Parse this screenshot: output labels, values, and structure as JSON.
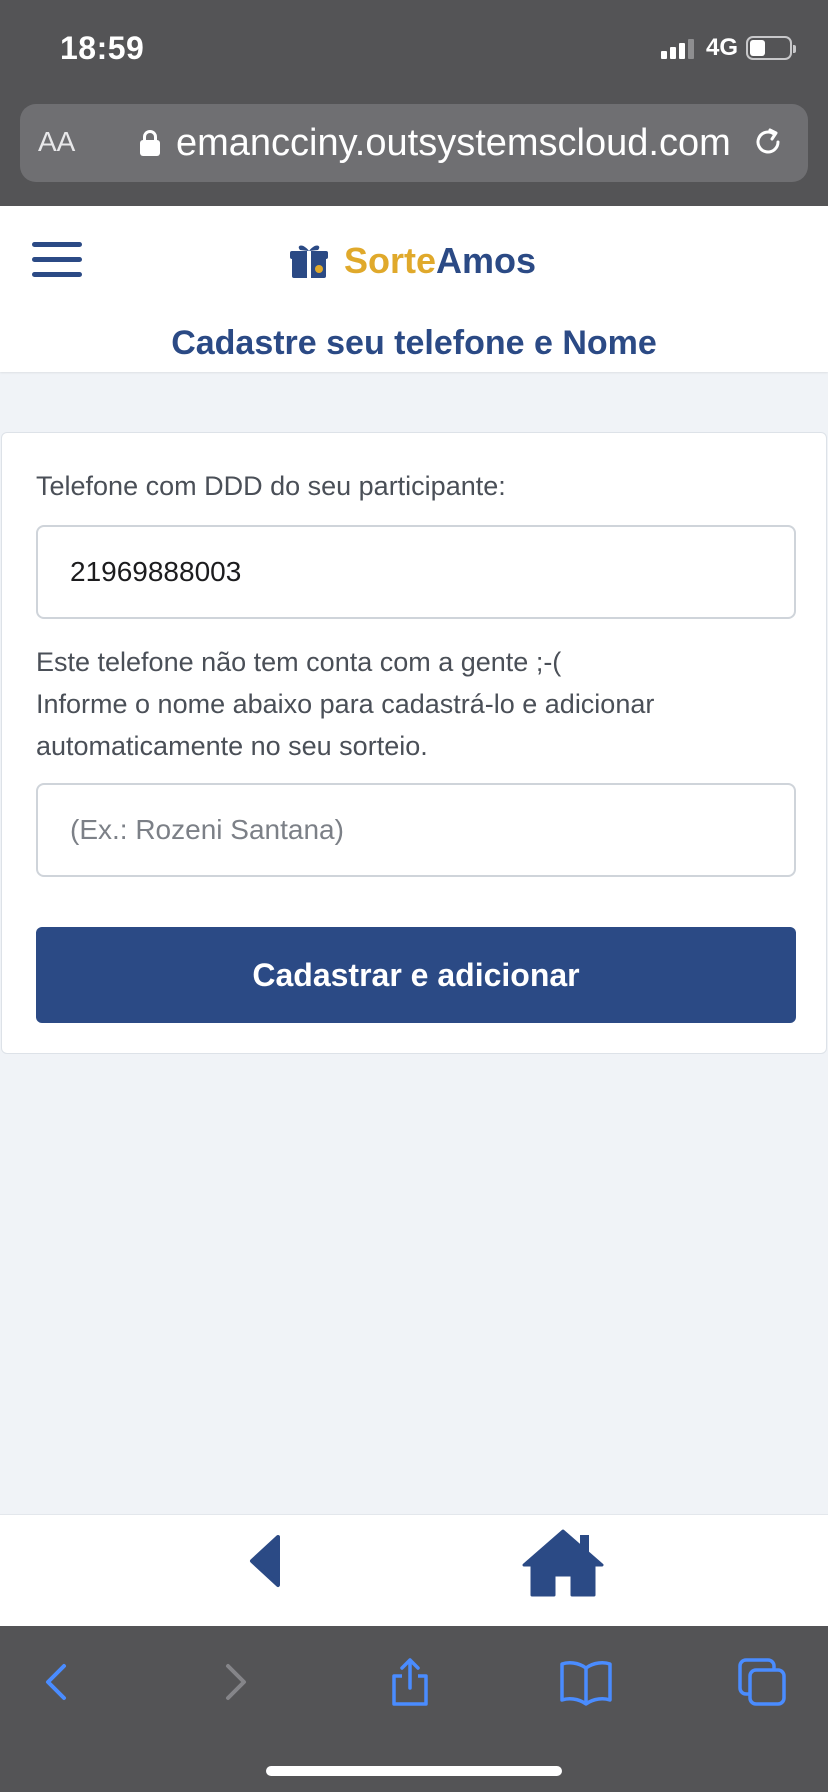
{
  "status_bar": {
    "time": "18:59",
    "network": "4G",
    "battery_level": 0.4
  },
  "browser": {
    "text_size_label": "AA",
    "url": "emancciny.outsystemscloud.com",
    "icons": [
      "lock-icon",
      "reload-icon",
      "back-arrow-icon",
      "forward-arrow-icon",
      "share-icon",
      "bookmarks-icon",
      "tabs-icon"
    ]
  },
  "header": {
    "brand_part1": "Sorte",
    "brand_part2": "Amos",
    "page_title": "Cadastre seu telefone e Nome",
    "colors": {
      "primary": "#2b4a85",
      "accent": "#e0a92b"
    }
  },
  "form": {
    "phone_label": "Telefone com DDD do seu participante:",
    "phone_value": "21969888003",
    "message_line1": "Este telefone não tem conta com a gente ;-(",
    "message_line2": "Informe o nome abaixo para cadastrá-lo e adicionar",
    "message_line3": "automaticamente no seu sorteio.",
    "name_placeholder": "(Ex.: Rozeni Santana)",
    "name_value": "",
    "submit_label": "Cadastrar e adicionar"
  },
  "bottom_nav": {
    "icons": [
      "back-triangle-icon",
      "home-icon"
    ]
  }
}
